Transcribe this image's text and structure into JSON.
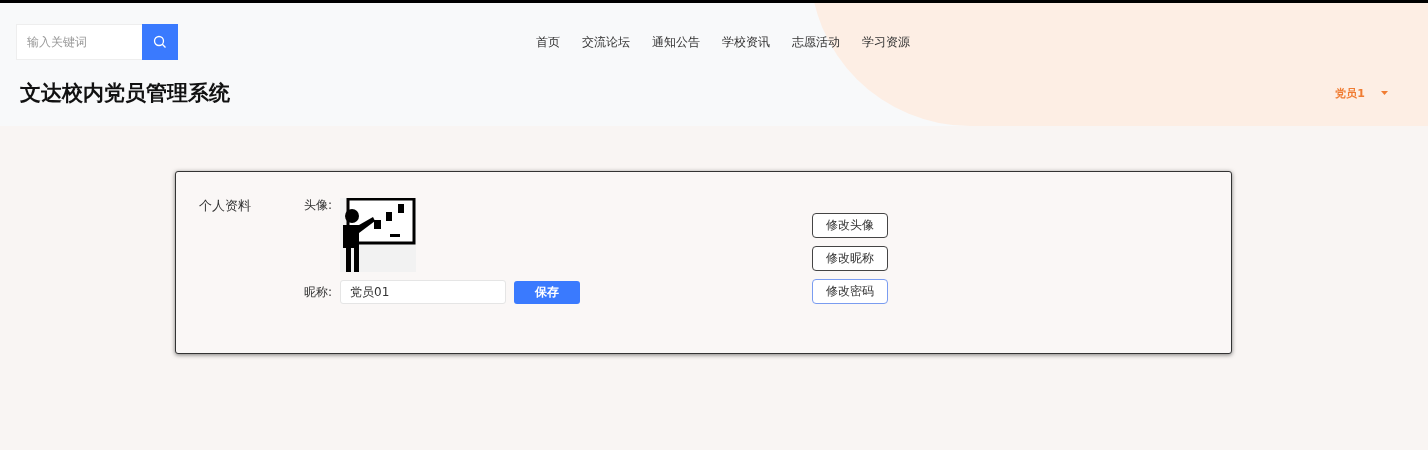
{
  "search": {
    "placeholder": "输入关键词"
  },
  "nav": [
    {
      "label": "首页"
    },
    {
      "label": "交流论坛"
    },
    {
      "label": "通知公告"
    },
    {
      "label": "学校资讯"
    },
    {
      "label": "志愿活动"
    },
    {
      "label": "学习资源"
    }
  ],
  "site_title": "文达校内党员管理系统",
  "user_menu": {
    "label": "党员1"
  },
  "profile": {
    "section_title": "个人资料",
    "avatar_label": "头像:",
    "nickname_label": "昵称:",
    "nickname_value": "党员01",
    "save_button": "保存",
    "actions": [
      {
        "label": "修改头像",
        "focused": false
      },
      {
        "label": "修改昵称",
        "focused": false
      },
      {
        "label": "修改密码",
        "focused": true
      }
    ]
  }
}
